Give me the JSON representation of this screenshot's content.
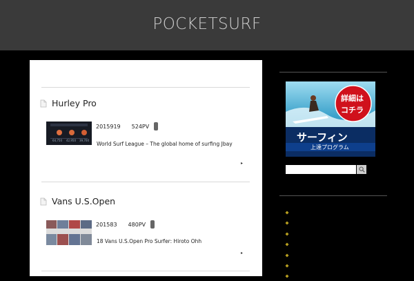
{
  "site": {
    "logo": "POCKETSURF"
  },
  "posts": [
    {
      "title": "Hurley Pro",
      "date": "2015919",
      "views": "524PV",
      "excerpt": "World Surf League – The global home of surfing Jbay",
      "thumb_stats": [
        "64,750",
        "42,950",
        "39,700"
      ]
    },
    {
      "title": "Vans U.S.Open",
      "date": "201583",
      "views": "480PV",
      "excerpt": "18 Vans U.S.Open  Pro Surfer: Hiroto Ohh"
    }
  ],
  "more_symbol": "▸",
  "sidebar": {
    "banner": {
      "badge_line1": "詳細は",
      "badge_line2": "コチラ",
      "headline": "サーフィン",
      "subline": "上達プログラム"
    },
    "search": {
      "placeholder": ""
    },
    "list_item_count": 7
  },
  "colors": {
    "header": "#3a3a3a",
    "background": "#000000",
    "content": "#ffffff",
    "banner_blue": "#0b2d63",
    "badge_red": "#d0111c"
  }
}
